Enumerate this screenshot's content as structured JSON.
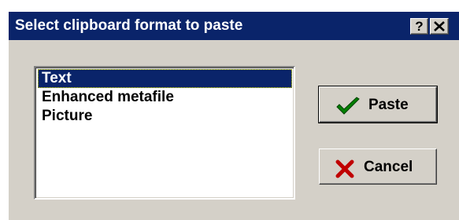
{
  "window": {
    "title": "Select clipboard format to paste",
    "help_glyph": "?",
    "close_icon": "close-icon"
  },
  "formats": {
    "items": [
      "Text",
      "Enhanced metafile",
      "Picture"
    ],
    "selected": "Text"
  },
  "buttons": {
    "paste_label": "Paste",
    "paste_icon": "check-icon",
    "cancel_label": "Cancel",
    "cancel_icon": "x-icon"
  },
  "colors": {
    "titlebar": "#0a246a",
    "face": "#d4d0c8",
    "check": "#008000",
    "cancel_x": "#c00000"
  }
}
